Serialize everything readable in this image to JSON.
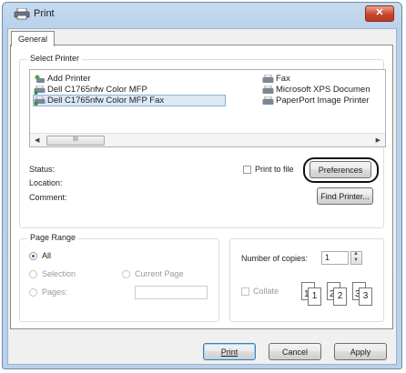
{
  "window": {
    "title": "Print",
    "close_symbol": "✕"
  },
  "tabs": [
    {
      "label": "General"
    }
  ],
  "select_printer": {
    "group_label": "Select Printer",
    "printers": [
      {
        "name": "Add Printer"
      },
      {
        "name": "Dell C1765nfw Color MFP"
      },
      {
        "name": "Dell C1765nfw Color MFP Fax",
        "selected": true
      },
      {
        "name": "Fax"
      },
      {
        "name": "Microsoft XPS Documen"
      },
      {
        "name": "PaperPort Image Printer"
      }
    ],
    "scroll_thumb_grip": "III",
    "status_label": "Status:",
    "location_label": "Location:",
    "comment_label": "Comment:",
    "print_to_file_label": "Print to file",
    "preferences_button": "Preferences",
    "find_printer_button": "Find Printer..."
  },
  "page_range": {
    "group_label": "Page Range",
    "all_label": "All",
    "selection_label": "Selection",
    "current_page_label": "Current Page",
    "pages_label": "Pages:",
    "pages_value": ""
  },
  "copies": {
    "number_label": "Number of copies:",
    "number_value": "1",
    "collate_label": "Collate",
    "collate_icon": [
      "1",
      "1",
      "2",
      "2",
      "3",
      "3"
    ]
  },
  "footer": {
    "print_button": "Print",
    "cancel_button": "Cancel",
    "apply_button": "Apply"
  },
  "colors": {
    "title_bar": "#b9d1ea",
    "close_button": "#c8452c",
    "selection_bg": "#dce8f4",
    "accent": "#2a62b8"
  }
}
